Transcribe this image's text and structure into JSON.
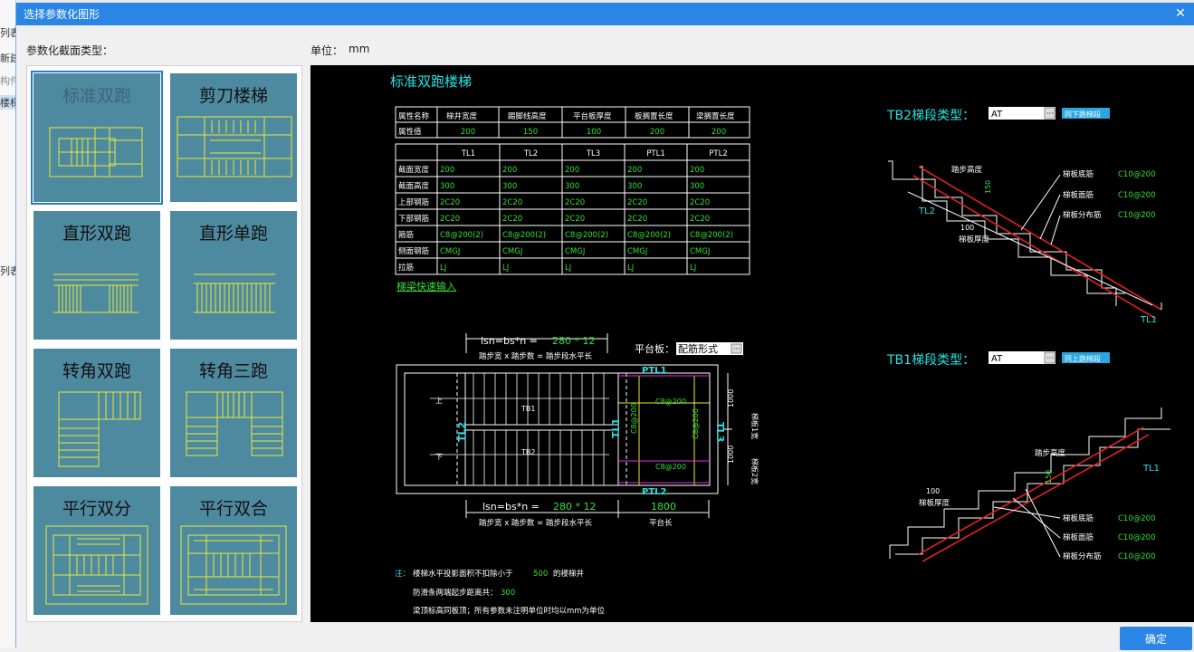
{
  "background_app": {
    "items": [
      "列表",
      "新建",
      "构件",
      "楼梯",
      "列表"
    ]
  },
  "dialog": {
    "title": "选择参数化图形",
    "type_label": "参数化截面类型：",
    "unit_label": "单位：",
    "unit_value": "mm",
    "ok_label": "确定"
  },
  "tiles": [
    {
      "name": "标准双跑"
    },
    {
      "name": "剪刀楼梯"
    },
    {
      "name": "直形双跑"
    },
    {
      "name": "直形单跑"
    },
    {
      "name": "转角双跑"
    },
    {
      "name": "转角三跑"
    },
    {
      "name": "平行双分"
    },
    {
      "name": "平行双合"
    }
  ],
  "cad": {
    "title": "标准双跑楼梯",
    "attr_table": {
      "row_headers": [
        "属性名称",
        "属性值"
      ],
      "columns": [
        "梯井宽度",
        "踢脚线高度",
        "平台板厚度",
        "板搁置长度",
        "梁搁置长度"
      ],
      "values": [
        "200",
        "150",
        "100",
        "200",
        "200"
      ]
    },
    "beam_table": {
      "columns": [
        "TL1",
        "TL2",
        "TL3",
        "PTL1",
        "PTL2"
      ],
      "rows": [
        {
          "label": "截面宽度",
          "cells": [
            "200",
            "200",
            "200",
            "200",
            "200"
          ]
        },
        {
          "label": "截面高度",
          "cells": [
            "300",
            "300",
            "300",
            "300",
            "300"
          ]
        },
        {
          "label": "上部钢筋",
          "cells": [
            "2C20",
            "2C20",
            "2C20",
            "2C20",
            "2C20"
          ]
        },
        {
          "label": "下部钢筋",
          "cells": [
            "2C20",
            "2C20",
            "2C20",
            "2C20",
            "2C20"
          ]
        },
        {
          "label": "箍筋",
          "cells": [
            "C8@200(2)",
            "C8@200(2)",
            "C8@200(2)",
            "C8@200(2)",
            "C8@200(2)"
          ]
        },
        {
          "label": "侧面钢筋",
          "cells": [
            "CMGJ",
            "CMGJ",
            "CMGJ",
            "CMGJ",
            "CMGJ"
          ]
        },
        {
          "label": "拉筋",
          "cells": [
            "LJ",
            "LJ",
            "LJ",
            "LJ",
            "LJ"
          ]
        }
      ]
    },
    "quick_input_link": "梯梁快速输入",
    "plan": {
      "formula_top_prefix": "lsn=bs*n = ",
      "formula_top_value": "280 * 12",
      "formula_desc": "踏步宽 x 踏步数 = 踏步段水平长",
      "formula_bottom_prefix": "lsn=bs*n = ",
      "formula_bottom_value": "280 * 12",
      "platform_len_value": "1800",
      "platform_len_label": "平台长",
      "platform_board_label": "平台板：",
      "platform_board_value": "配筋形式",
      "labels": {
        "ptl1": "PTL1",
        "ptl2": "PTL2",
        "tl1": "TL1",
        "tl2": "TL2",
        "tl3": "TL3",
        "tb1": "TB1",
        "tb2": "TB2",
        "up": "上",
        "down": "下",
        "rebar1": "C8@200",
        "rebar2": "C8@200",
        "rebar_v1": "C8@200",
        "rebar_v2": "C8@200",
        "dim1": "1000",
        "dim2": "1000",
        "width1": "梯板1宽",
        "width2": "梯板2宽"
      }
    },
    "tb2": {
      "label": "TB2梯段类型：",
      "type_value": "AT",
      "same_btn": "同下跑梯段",
      "step_height": "踏步高度",
      "dim_150": "150",
      "dim_100": "100",
      "thickness": "梯板厚度",
      "bottom_rebar": "梯板底筋",
      "top_rebar": "梯板面筋",
      "dist_rebar": "梯板分布筋",
      "rebar_val1": "C10@200",
      "rebar_val2": "C10@200",
      "rebar_val3": "C10@200",
      "tl_left": "TL2",
      "tl_right": "TL1"
    },
    "tb1": {
      "label": "TB1梯段类型：",
      "type_value": "AT",
      "same_btn": "同上跑梯段",
      "step_height": "踏步高度",
      "dim_150": "150",
      "dim_100": "100",
      "thickness": "梯板厚度",
      "bottom_rebar": "梯板底筋",
      "top_rebar": "梯板面筋",
      "dist_rebar": "梯板分布筋",
      "rebar_val1": "C10@200",
      "rebar_val2": "C10@200",
      "rebar_val3": "C10@200",
      "tl_right": "TL1"
    },
    "notes": {
      "prefix": "注：",
      "line1_a": "楼梯水平投影面积不扣除小于",
      "line1_b": "500",
      "line1_c": "的楼梯井",
      "line2_a": "防滑条两端起步距离共：",
      "line2_b": "300",
      "line3": "梁顶标高同板顶；所有参数未注明单位时均以mm为单位"
    }
  },
  "colors": {
    "accent": "#2b85e4",
    "tile_bg": "#4d8aa0",
    "cad_bg": "#000000",
    "cad_cyan": "#24e4e4",
    "cad_green": "#35e035",
    "cad_yellow": "#e8e83a",
    "cad_red": "#e02020"
  }
}
